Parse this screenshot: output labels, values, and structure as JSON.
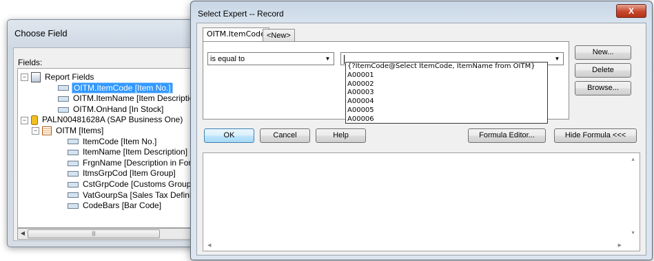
{
  "choose_field": {
    "title": "Choose Field",
    "fields_label": "Fields:",
    "tree": [
      {
        "label": "Report Fields",
        "expander": "−",
        "icon": "report-icon",
        "level": 0,
        "selected": false
      },
      {
        "label": "OITM.ItemCode [Item No.]",
        "icon": "field-icon",
        "level": 1,
        "selected": true
      },
      {
        "label": "OITM.ItemName [Item Description]",
        "icon": "field-icon",
        "level": 1,
        "selected": false
      },
      {
        "label": "OITM.OnHand [In Stock]",
        "icon": "field-icon",
        "level": 1,
        "selected": false
      },
      {
        "label": "PALN00481628A (SAP Business One)",
        "expander": "−",
        "icon": "database-icon",
        "level": 0,
        "selected": false
      },
      {
        "label": "OITM [Items]",
        "expander": "−",
        "icon": "table-icon",
        "level": 1,
        "selected": false
      },
      {
        "label": "ItemCode [Item No.]",
        "icon": "field-icon",
        "level": 2,
        "selected": false
      },
      {
        "label": "ItemName [Item Description]",
        "icon": "field-icon",
        "level": 2,
        "selected": false
      },
      {
        "label": "FrgnName [Description in Foreign Language]",
        "icon": "field-icon",
        "level": 2,
        "selected": false
      },
      {
        "label": "ItmsGrpCod [Item Group]",
        "icon": "field-icon",
        "level": 2,
        "selected": false
      },
      {
        "label": "CstGrpCode [Customs Group]",
        "icon": "field-icon",
        "level": 2,
        "selected": false
      },
      {
        "label": "VatGourpSa [Sales Tax Definition]",
        "icon": "field-icon",
        "level": 2,
        "selected": false
      },
      {
        "label": "CodeBars [Bar Code]",
        "icon": "field-icon",
        "level": 2,
        "selected": false
      }
    ]
  },
  "select_expert": {
    "title": "Select Expert -- Record",
    "close_label": "X",
    "tabs": [
      {
        "label": "OITM.ItemCode",
        "active": true
      },
      {
        "label": "<New>",
        "active": false
      }
    ],
    "operator": "is equal to",
    "value": "",
    "dropdown_options": [
      "{?ItemCode@Select ItemCode, ItemName from OITM}",
      "A00001",
      "A00002",
      "A00003",
      "A00004",
      "A00005",
      "A00006"
    ],
    "side_buttons": {
      "new": "New...",
      "delete": "Delete",
      "browse": "Browse..."
    },
    "bottom_buttons": {
      "ok": "OK",
      "cancel": "Cancel",
      "help": "Help",
      "formula_editor": "Formula Editor...",
      "hide_formula": "Hide Formula <<<"
    },
    "formula_text": ""
  },
  "colors": {
    "selection": "#3399ff",
    "default_button": "#a7d9f5",
    "close_button": "#c7452c"
  }
}
